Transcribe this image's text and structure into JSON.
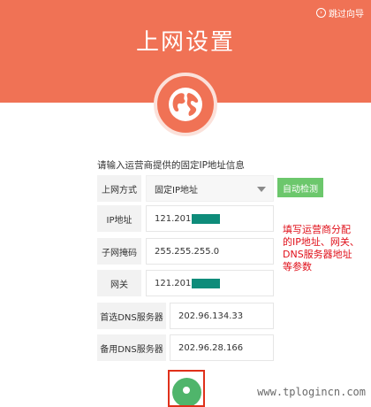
{
  "header": {
    "title": "上网设置",
    "skip_label": "跳过向导"
  },
  "form": {
    "prompt": "请输入运营商提供的固定IP地址信息",
    "connection_type": {
      "label": "上网方式",
      "value": "固定IP地址"
    },
    "auto_detect_label": "自动检测",
    "ip": {
      "label": "IP地址",
      "value": "121.201"
    },
    "subnet": {
      "label": "子网掩码",
      "value": "255.255.255.0"
    },
    "gateway": {
      "label": "网关",
      "value": "121.201"
    },
    "dns_primary": {
      "label": "首选DNS服务器",
      "value": "202.96.134.33"
    },
    "dns_secondary": {
      "label": "备用DNS服务器",
      "value": "202.96.28.166"
    }
  },
  "annotation": "填写运营商分配\n的IP地址、网关、\nDNS服务器地址\n等参数",
  "watermark": "www.tplogincn.com",
  "colors": {
    "header_bg": "#f07255",
    "auto_detect_bg": "#6cc76c",
    "annotation_text": "#e0101a",
    "next_button": "#4fb56b"
  },
  "icons": {
    "globe": "globe-icon",
    "skip": "skip-arrow-icon"
  }
}
